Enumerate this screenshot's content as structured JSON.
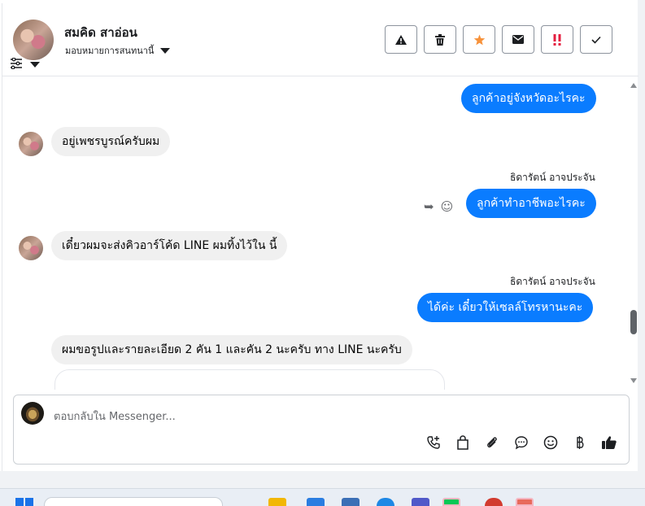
{
  "header": {
    "contact_name": "สมคิด สาอ่อน",
    "assign_label": "มอบหมายการสนทนานี้",
    "actions": [
      {
        "name": "report-button",
        "icon": "warning-icon",
        "glyph": "⚠",
        "color": "#1c1e21"
      },
      {
        "name": "delete-button",
        "icon": "trash-icon",
        "glyph": "🗑",
        "color": "#1c1e21"
      },
      {
        "name": "star-button",
        "icon": "star-icon",
        "glyph": "★",
        "color": "#f7923b"
      },
      {
        "name": "mark-unread-button",
        "icon": "envelope-icon",
        "glyph": "✉",
        "color": "#1c1e21"
      },
      {
        "name": "important-button",
        "icon": "double-exclamation-icon",
        "glyph": "‼",
        "color": "#e41e3f"
      },
      {
        "name": "mark-done-button",
        "icon": "check-icon",
        "glyph": "✓",
        "color": "#1c1e21"
      }
    ]
  },
  "messages": [
    {
      "type": "out",
      "text": "ลูกค้าอยู่จังหวัดอะไรคะ"
    },
    {
      "type": "in",
      "text": "อยู่เพชรบูรณ์ครับผม"
    },
    {
      "type": "sender",
      "text": "ธิดารัตน์ อาจประจัน"
    },
    {
      "type": "out",
      "text": "ลูกค้าทำอาชีพอะไรคะ"
    },
    {
      "type": "in",
      "text": "เดี๋ยวผมจะส่งคิวอาร์โค้ด LINE ผมทิ้งไว้ใน นี้"
    },
    {
      "type": "sender",
      "text": "ธิดารัตน์ อาจประจัน"
    },
    {
      "type": "out",
      "text": "ได้ค่ะ เดี๋ยวให้เซลล์โทรหานะคะ"
    },
    {
      "type": "in",
      "text": "ผมขอรูปและรายละเอียด 2 คัน 1 และคัน 2 นะครับ ทาง LINE นะครับ"
    }
  ],
  "composer": {
    "placeholder": "ตอบกลับใน Messenger...",
    "tools": [
      "phone-add-icon",
      "bag-icon",
      "paperclip-icon",
      "chat-bubble-icon",
      "emoji-icon",
      "baht-icon",
      "thumbs-up-icon"
    ]
  },
  "colors": {
    "outgoing_bubble": "#0a7cff",
    "incoming_bubble": "#f0f0f0",
    "star": "#f7923b",
    "important": "#e41e3f"
  }
}
